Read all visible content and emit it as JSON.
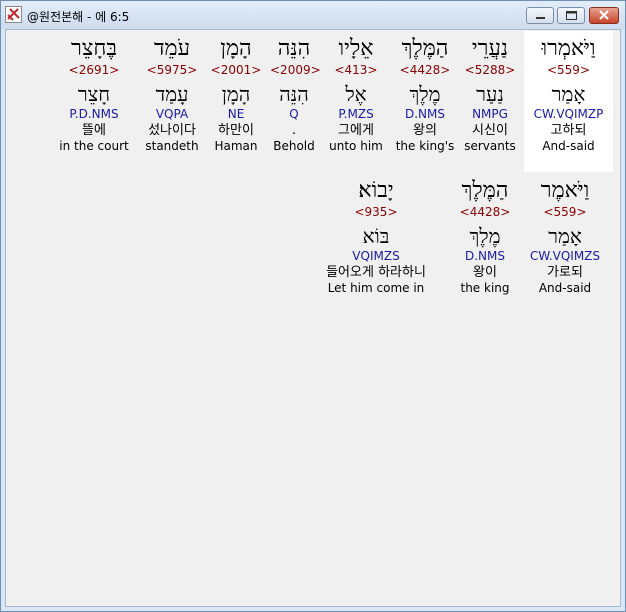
{
  "window": {
    "title": "@원전본해 - 에 6:5"
  },
  "rows": [
    {
      "words": [
        {
          "hebrew": "וַיֹּאמְרוּ",
          "strong": "<559>",
          "lemma": "אָמַר",
          "morph": "CW.VQIMZP",
          "korean": "고하되",
          "english": "And-said"
        },
        {
          "hebrew": "נַעֲרֵי",
          "strong": "<5288>",
          "lemma": "נַעַר",
          "morph": "NMPG",
          "korean": "시신이",
          "english": "servants"
        },
        {
          "hebrew": "הַמֶּלֶךְ",
          "strong": "<4428>",
          "lemma": "מֶלֶךְ",
          "morph": "D.NMS",
          "korean": "왕의",
          "english": "the king's"
        },
        {
          "hebrew": "אֵלָיו",
          "strong": "<413>",
          "lemma": "אֶל",
          "morph": "P.MZS",
          "korean": "그에게",
          "english": "unto him"
        },
        {
          "hebrew": "הִנֵּה",
          "strong": "<2009>",
          "lemma": "הִנֵּה",
          "morph": "Q",
          "korean": ".",
          "english": "Behold"
        },
        {
          "hebrew": "הָמָן",
          "strong": "<2001>",
          "lemma": "הָמָן",
          "morph": "NE",
          "korean": "하만이",
          "english": "Haman"
        },
        {
          "hebrew": "עֹמֵד",
          "strong": "<5975>",
          "lemma": "עָמַד",
          "morph": "VQPA",
          "korean": "섰나이다",
          "english": "standeth"
        },
        {
          "hebrew": "בֶּחָצֵר",
          "strong": "<2691>",
          "lemma": "חָצֵר",
          "morph": "P.D.NMS",
          "korean": "뜰에",
          "english": "in the court"
        }
      ]
    },
    {
      "words": [
        {
          "hebrew": "וַיֹּאמֶר",
          "strong": "<559>",
          "lemma": "אָמַר",
          "morph": "CW.VQIMZS",
          "korean": "가로되",
          "english": "And-said"
        },
        {
          "hebrew": "הַמֶּלֶךְ",
          "strong": "<4428>",
          "lemma": "מֶלֶךְ",
          "morph": "D.NMS",
          "korean": "왕이",
          "english": "the king"
        },
        {
          "hebrew": "יָבוֹא׃",
          "strong": "<935>",
          "lemma": "בּוֹא",
          "morph": "VQIMZS",
          "korean": "들어오게 하라하니",
          "english": "Let him come in"
        }
      ]
    }
  ]
}
